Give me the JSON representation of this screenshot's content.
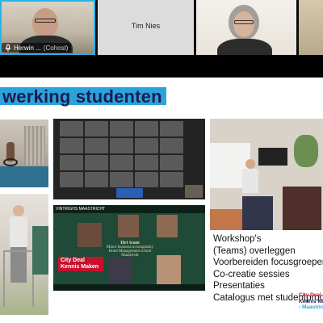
{
  "participants": [
    {
      "name": "Herwin ...",
      "role": "(Cohost)",
      "active_speaker": true
    },
    {
      "name": "Tim Nies"
    },
    {
      "name": ""
    }
  ],
  "slide": {
    "title": "werking studenten",
    "bullets": [
      "Workshop's",
      "(Teams) overleggen",
      "Voorbereiden focusgroepen",
      "Co-creatie sessies",
      "Presentaties",
      "Catalogus met studentprod"
    ],
    "team_photo": {
      "header": "VINTRIGHS MAASTRICHT",
      "heading": "Het team",
      "subtext": "Minor business in hospitality Hotel Management school Maastricht",
      "badge": [
        "City Deal",
        "Kennis Maken"
      ]
    },
    "brand": [
      "City Deal",
      "Kennis Mak",
      "› Maastrich"
    ]
  },
  "colors": {
    "accent_blue": "#2aa3dd",
    "title_navy": "#1e1c4e",
    "brand_red": "#c8102e",
    "active_speaker_ring": "#27b4e8"
  },
  "icons": {
    "mic": "microphone-icon"
  }
}
